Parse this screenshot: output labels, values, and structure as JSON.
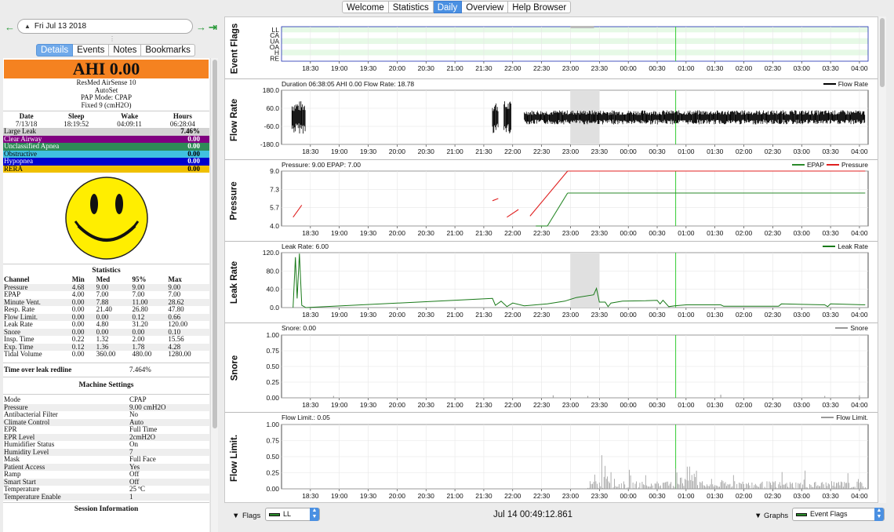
{
  "top_tabs": [
    "Welcome",
    "Statistics",
    "Daily",
    "Overview",
    "Help Browser"
  ],
  "active_tab": "Daily",
  "date": "Fri Jul 13 2018",
  "left_tabs": [
    "Details",
    "Events",
    "Notes",
    "Bookmarks"
  ],
  "ahi_banner": "AHI 0.00",
  "machine": {
    "model": "ResMed AirSense 10",
    "variant": "AutoSet",
    "pap_mode": "PAP Mode: CPAP",
    "fixed": "Fixed 9 (cmH2O)"
  },
  "session_header": [
    "Date",
    "Sleep",
    "Wake",
    "Hours"
  ],
  "session_values": [
    "7/13/18",
    "18:19:52",
    "04:09:11",
    "06:28:04"
  ],
  "events": [
    {
      "name": "Large Leak",
      "value": "7.46%",
      "color": "#d3d3d3",
      "text": "#000000"
    },
    {
      "name": "Clear Airway",
      "value": "0.00",
      "color": "#800080",
      "text": "#ffffff"
    },
    {
      "name": "Unclassified Apnea",
      "value": "0.00",
      "color": "#2e8b57",
      "text": "#ffffff"
    },
    {
      "name": "Obstructive",
      "value": "0.00",
      "color": "#40c0e0",
      "text": "#000000"
    },
    {
      "name": "Hypopnea",
      "value": "0.00",
      "color": "#0000cd",
      "text": "#ffffff"
    },
    {
      "name": "RERA",
      "value": "0.00",
      "color": "#f0c000",
      "text": "#000000"
    }
  ],
  "statistics": {
    "title": "Statistics",
    "headers": [
      "Channel",
      "Min",
      "Med",
      "95%",
      "Max"
    ],
    "rows": [
      [
        "Pressure",
        "4.68",
        "9.00",
        "9.00",
        "9.00"
      ],
      [
        "EPAP",
        "4.00",
        "7.00",
        "7.00",
        "7.00"
      ],
      [
        "Minute Vent.",
        "0.00",
        "7.88",
        "11.00",
        "28.62"
      ],
      [
        "Resp. Rate",
        "0.00",
        "21.40",
        "26.80",
        "47.80"
      ],
      [
        "Flow Limit.",
        "0.00",
        "0.00",
        "0.12",
        "0.66"
      ],
      [
        "Leak Rate",
        "0.00",
        "4.80",
        "31.20",
        "120.00"
      ],
      [
        "Snore",
        "0.00",
        "0.00",
        "0.00",
        "0.10"
      ],
      [
        "Insp. Time",
        "0.22",
        "1.32",
        "2.00",
        "15.56"
      ],
      [
        "Exp. Time",
        "0.12",
        "1.36",
        "1.78",
        "4.28"
      ],
      [
        "Tidal Volume",
        "0.00",
        "360.00",
        "480.00",
        "1280.00"
      ]
    ]
  },
  "leak_redline": {
    "label": "Time over leak redline",
    "value": "7.464%"
  },
  "machine_settings": {
    "title": "Machine Settings",
    "rows": [
      [
        "Mode",
        "CPAP"
      ],
      [
        "Pressure",
        "9.00 cmH2O"
      ],
      [
        "Antibacterial Filter",
        "No"
      ],
      [
        "Climate Control",
        "Auto"
      ],
      [
        "EPR",
        "Full Time"
      ],
      [
        "EPR Level",
        "2cmH2O"
      ],
      [
        "Humidifier Status",
        "On"
      ],
      [
        "Humidity Level",
        "7"
      ],
      [
        "Mask",
        "Full Face"
      ],
      [
        "Patient Access",
        "Yes"
      ],
      [
        "Ramp",
        "Off"
      ],
      [
        "Smart Start",
        "Off"
      ],
      [
        "Temperature",
        "25 ºC"
      ],
      [
        "Temperature Enable",
        "1"
      ]
    ]
  },
  "session_info_title": "Session Information",
  "time_ticks": [
    "18:30",
    "19:00",
    "19:30",
    "20:00",
    "20:30",
    "21:00",
    "21:30",
    "22:00",
    "22:30",
    "23:00",
    "23:30",
    "00:00",
    "00:30",
    "01:00",
    "01:30",
    "02:00",
    "02:30",
    "03:00",
    "03:30",
    "04:00"
  ],
  "graphs": {
    "event_flags": {
      "label": "Event Flags",
      "rows": [
        "LL",
        "CA",
        "UA",
        "OA",
        "H",
        "RE"
      ]
    },
    "flow_rate": {
      "label": "Flow Rate",
      "title": "Duration 06:38:05 AHI 0.00 Flow Rate: 18.78",
      "legend": "Flow Rate",
      "yticks": [
        "180.0",
        "60.0",
        "-60.0",
        "-180.0"
      ],
      "color": "#000000"
    },
    "pressure": {
      "label": "Pressure",
      "title": "Pressure: 9.00 EPAP: 7.00",
      "legend": [
        "EPAP",
        "Pressure"
      ],
      "yticks": [
        "9.0",
        "7.3",
        "5.7",
        "4.0"
      ],
      "epap_color": "#2a8a2a",
      "pressure_color": "#e02020"
    },
    "leak_rate": {
      "label": "Leak Rate",
      "title": "Leak Rate: 6.00",
      "legend": "Leak Rate",
      "yticks": [
        "120.0",
        "80.0",
        "40.0",
        "0.0"
      ],
      "color": "#1a7a1a"
    },
    "snore": {
      "label": "Snore",
      "title": "Snore: 0.00",
      "legend": "Snore",
      "yticks": [
        "1.00",
        "0.75",
        "0.50",
        "0.25",
        "0.00"
      ],
      "color": "#999999"
    },
    "flow_limit": {
      "label": "Flow Limit.",
      "title": "Flow Limit.: 0.05",
      "legend": "Flow Limit.",
      "yticks": [
        "1.00",
        "0.75",
        "0.50",
        "0.25",
        "0.00"
      ],
      "color": "#999999"
    }
  },
  "bottom": {
    "flags_label": "Flags",
    "flags_value": "LL",
    "time": "Jul 14 00:49:12.861",
    "graphs_label": "Graphs",
    "graphs_value": "Event Flags"
  }
}
